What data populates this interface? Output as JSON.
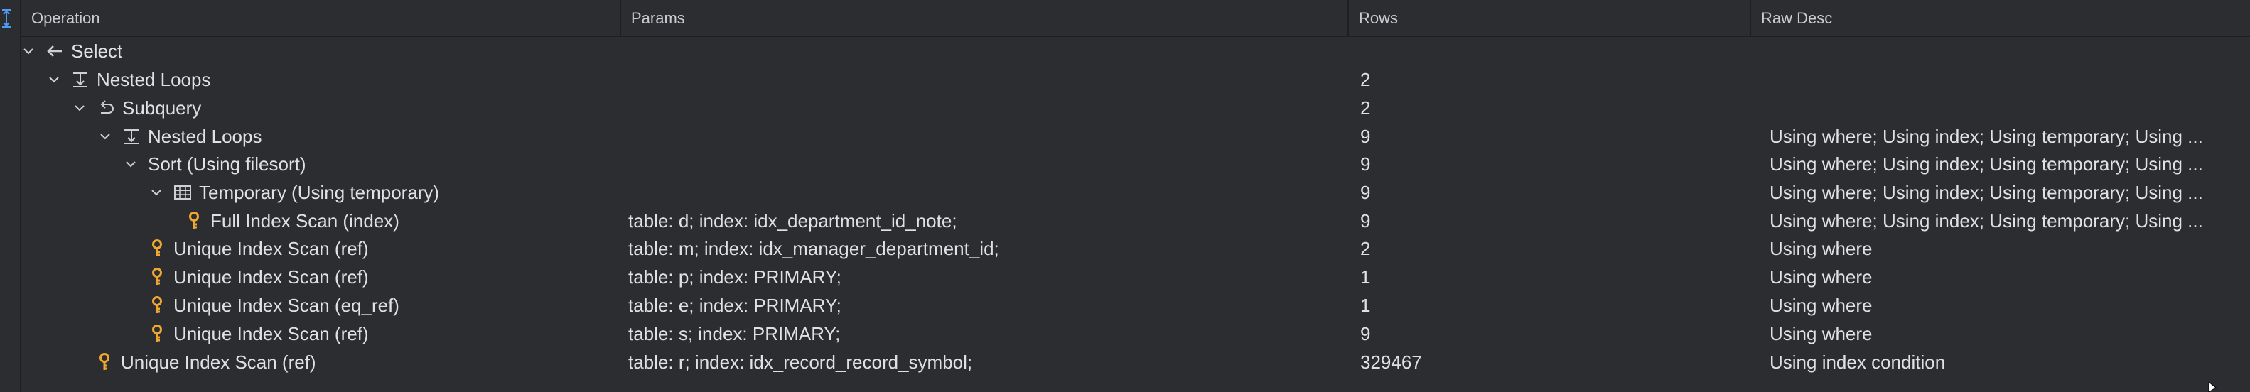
{
  "columns": {
    "operation": "Operation",
    "params": "Params",
    "rows": "Rows",
    "raw_desc": "Raw Desc"
  },
  "rows": [
    {
      "operation": "Select",
      "params": "",
      "rows": "",
      "raw_desc": "",
      "icon": "select-arrow-icon",
      "expanded": true
    },
    {
      "operation": "Nested Loops",
      "params": "",
      "rows": "2",
      "raw_desc": "",
      "icon": "nested-loops-icon",
      "expanded": true
    },
    {
      "operation": "Subquery",
      "params": "",
      "rows": "2",
      "raw_desc": "",
      "icon": "subquery-icon",
      "expanded": true
    },
    {
      "operation": "Nested Loops",
      "params": "",
      "rows": "9",
      "raw_desc": "Using where; Using index; Using temporary; Using ...",
      "icon": "nested-loops-icon",
      "expanded": true
    },
    {
      "operation": "Sort (Using filesort)",
      "params": "",
      "rows": "9",
      "raw_desc": "Using where; Using index; Using temporary; Using ...",
      "icon": "",
      "expanded": true
    },
    {
      "operation": "Temporary (Using temporary)",
      "params": "",
      "rows": "9",
      "raw_desc": "Using where; Using index; Using temporary; Using ...",
      "icon": "table-icon",
      "expanded": true
    },
    {
      "operation": "Full Index Scan (index)",
      "params": "table: d; index: idx_department_id_note;",
      "rows": "9",
      "raw_desc": "Using where; Using index; Using temporary; Using ...",
      "icon": "key-icon",
      "expanded": null
    },
    {
      "operation": "Unique Index Scan (ref)",
      "params": "table: m; index: idx_manager_department_id;",
      "rows": "2",
      "raw_desc": "Using where",
      "icon": "key-icon",
      "expanded": null
    },
    {
      "operation": "Unique Index Scan (ref)",
      "params": "table: p; index: PRIMARY;",
      "rows": "1",
      "raw_desc": "Using where",
      "icon": "key-icon",
      "expanded": null
    },
    {
      "operation": "Unique Index Scan (eq_ref)",
      "params": "table: e; index: PRIMARY;",
      "rows": "1",
      "raw_desc": "Using where",
      "icon": "key-icon",
      "expanded": null
    },
    {
      "operation": "Unique Index Scan (ref)",
      "params": "table: s; index: PRIMARY;",
      "rows": "9",
      "raw_desc": "Using where",
      "icon": "key-icon",
      "expanded": null
    },
    {
      "operation": "Unique Index Scan (ref)",
      "params": "table: r; index: idx_record_record_symbol;",
      "rows": "329467",
      "raw_desc": "Using index condition",
      "icon": "key-icon",
      "expanded": null
    }
  ],
  "colors": {
    "background": "#2b2d30",
    "text": "#dfe1e5",
    "header_text": "#c9ccd1",
    "key_icon": "#f0a732",
    "icon_gray": "#ced0d6",
    "accent": "#3574f0"
  }
}
